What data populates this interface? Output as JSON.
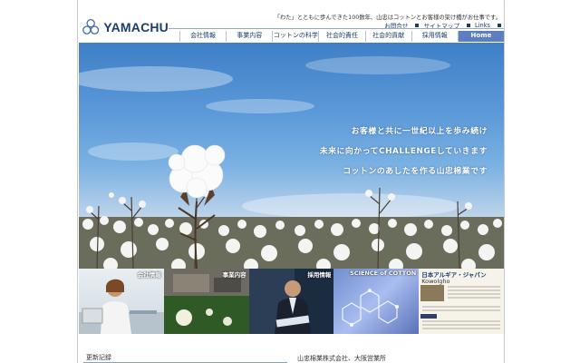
{
  "header": {
    "logo_text": "YAMACHU",
    "tagline": "「わた」とともに歩んできた100数年、山忠はコットンとお客様の架け橋がお仕事です。",
    "util_links": [
      "お問合せ",
      "サイトマップ",
      "Links"
    ]
  },
  "nav": {
    "items": [
      "会社情報",
      "事業内容",
      "コットンの科学",
      "社会的責任",
      "社会的貢献",
      "採用情報",
      "Home"
    ]
  },
  "hero": {
    "lines": [
      "お客様と共に一世紀以上を歩み続け",
      "未来に向かってCHALLENGEしていきます",
      "コットンのあしたを作る山忠棉業です"
    ]
  },
  "tiles": [
    {
      "label": "会社情報"
    },
    {
      "label": "事業内容"
    },
    {
      "label": "採用情報"
    },
    {
      "label": "SCIENCE of COTTON"
    },
    {
      "label": "日本アルギア・ジャパン",
      "sub": "Kowolgho"
    }
  ],
  "footer": {
    "news_title": "更新記録",
    "company": "山忠棉業株式会社、大阪営業所"
  },
  "colors": {
    "brand": "#1b3d6e",
    "nav_active": "#5e7fbf",
    "sky": "#4f8fd0"
  }
}
